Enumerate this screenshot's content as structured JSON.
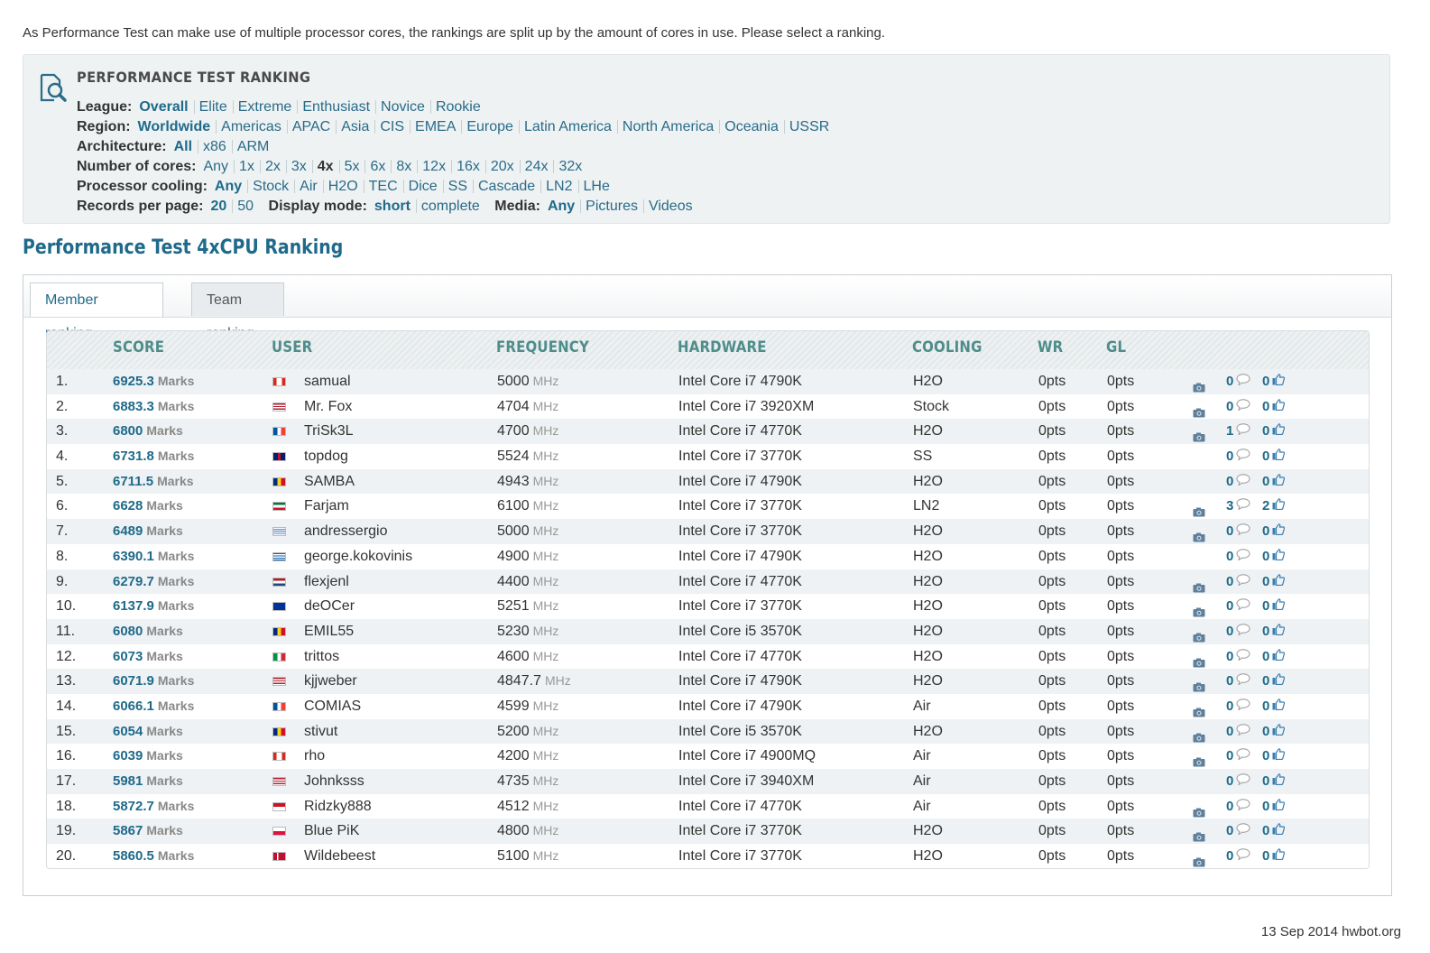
{
  "intro": "As Performance Test can make use of multiple processor cores, the rankings are split up by the amount of cores in use. Please select a ranking.",
  "filters": {
    "title": "PERFORMANCE TEST RANKING",
    "league": {
      "label": "League:",
      "options": [
        "Overall",
        "Elite",
        "Extreme",
        "Enthusiast",
        "Novice",
        "Rookie"
      ],
      "selected": "Overall"
    },
    "region": {
      "label": "Region:",
      "options": [
        "Worldwide",
        "Americas",
        "APAC",
        "Asia",
        "CIS",
        "EMEA",
        "Europe",
        "Latin America",
        "North America",
        "Oceania",
        "USSR"
      ],
      "selected": "Worldwide"
    },
    "architecture": {
      "label": "Architecture:",
      "options": [
        "All",
        "x86",
        "ARM"
      ],
      "selected": "All"
    },
    "cores": {
      "label": "Number of cores:",
      "options": [
        "Any",
        "1x",
        "2x",
        "3x",
        "4x",
        "5x",
        "6x",
        "8x",
        "12x",
        "16x",
        "20x",
        "24x",
        "32x"
      ],
      "selected": "4x"
    },
    "cooling": {
      "label": "Processor cooling:",
      "options": [
        "Any",
        "Stock",
        "Air",
        "H2O",
        "TEC",
        "Dice",
        "SS",
        "Cascade",
        "LN2",
        "LHe"
      ],
      "selected": "Any"
    },
    "records": {
      "label": "Records per page:",
      "options": [
        "20",
        "50"
      ],
      "selected": "20"
    },
    "display": {
      "label": "Display mode:",
      "options": [
        "short",
        "complete"
      ],
      "selected": "short"
    },
    "media": {
      "label": "Media:",
      "options": [
        "Any",
        "Pictures",
        "Videos"
      ],
      "selected": "Any"
    }
  },
  "section_title": "Performance Test 4xCPU Ranking",
  "tabs": [
    {
      "label": "Member ranking",
      "active": true
    },
    {
      "label": "Team ranking",
      "active": false
    }
  ],
  "columns": {
    "score": "SCORE",
    "user": "USER",
    "frequency": "FREQUENCY",
    "hardware": "HARDWARE",
    "cooling": "COOLING",
    "wr": "WR",
    "gl": "GL"
  },
  "score_unit": "Marks",
  "freq_unit": "MHz",
  "rows": [
    {
      "rank": "1.",
      "score": "6925.3",
      "flag": "ca",
      "user": "samual",
      "freq": "5000",
      "hw": "Intel Core i7 4790K",
      "cooling": "H2O",
      "wr": "0pts",
      "gl": "0pts",
      "camera": true,
      "comments": "0",
      "likes": "0"
    },
    {
      "rank": "2.",
      "score": "6883.3",
      "flag": "us",
      "user": "Mr. Fox",
      "freq": "4704",
      "hw": "Intel Core i7 3920XM",
      "cooling": "Stock",
      "wr": "0pts",
      "gl": "0pts",
      "camera": true,
      "comments": "0",
      "likes": "0"
    },
    {
      "rank": "3.",
      "score": "6800",
      "flag": "fr",
      "user": "TriSk3L",
      "freq": "4700",
      "hw": "Intel Core i7 4770K",
      "cooling": "H2O",
      "wr": "0pts",
      "gl": "0pts",
      "camera": true,
      "comments": "1",
      "likes": "0"
    },
    {
      "rank": "4.",
      "score": "6731.8",
      "flag": "gb",
      "user": "topdog",
      "freq": "5524",
      "hw": "Intel Core i7 3770K",
      "cooling": "SS",
      "wr": "0pts",
      "gl": "0pts",
      "camera": false,
      "comments": "0",
      "likes": "0"
    },
    {
      "rank": "5.",
      "score": "6711.5",
      "flag": "ro",
      "user": "SAMBA",
      "freq": "4943",
      "hw": "Intel Core i7 4790K",
      "cooling": "H2O",
      "wr": "0pts",
      "gl": "0pts",
      "camera": false,
      "comments": "0",
      "likes": "0"
    },
    {
      "rank": "6.",
      "score": "6628",
      "flag": "kw",
      "user": "Farjam",
      "freq": "6100",
      "hw": "Intel Core i7 3770K",
      "cooling": "LN2",
      "wr": "0pts",
      "gl": "0pts",
      "camera": true,
      "comments": "3",
      "likes": "2"
    },
    {
      "rank": "7.",
      "score": "6489",
      "flag": "uy",
      "user": "andressergio",
      "freq": "5000",
      "hw": "Intel Core i7 3770K",
      "cooling": "H2O",
      "wr": "0pts",
      "gl": "0pts",
      "camera": true,
      "comments": "0",
      "likes": "0"
    },
    {
      "rank": "8.",
      "score": "6390.1",
      "flag": "gr",
      "user": "george.kokovinis",
      "freq": "4900",
      "hw": "Intel Core i7 4790K",
      "cooling": "H2O",
      "wr": "0pts",
      "gl": "0pts",
      "camera": false,
      "comments": "0",
      "likes": "0"
    },
    {
      "rank": "9.",
      "score": "6279.7",
      "flag": "nl",
      "user": "flexjenl",
      "freq": "4400",
      "hw": "Intel Core i7 4770K",
      "cooling": "H2O",
      "wr": "0pts",
      "gl": "0pts",
      "camera": true,
      "comments": "0",
      "likes": "0"
    },
    {
      "rank": "10.",
      "score": "6137.9",
      "flag": "eu",
      "user": "deOCer",
      "freq": "5251",
      "hw": "Intel Core i7 3770K",
      "cooling": "H2O",
      "wr": "0pts",
      "gl": "0pts",
      "camera": true,
      "comments": "0",
      "likes": "0"
    },
    {
      "rank": "11.",
      "score": "6080",
      "flag": "ro",
      "user": "EMIL55",
      "freq": "5230",
      "hw": "Intel Core i5 3570K",
      "cooling": "H2O",
      "wr": "0pts",
      "gl": "0pts",
      "camera": true,
      "comments": "0",
      "likes": "0"
    },
    {
      "rank": "12.",
      "score": "6073",
      "flag": "it",
      "user": "trittos",
      "freq": "4600",
      "hw": "Intel Core i7 4770K",
      "cooling": "H2O",
      "wr": "0pts",
      "gl": "0pts",
      "camera": true,
      "comments": "0",
      "likes": "0"
    },
    {
      "rank": "13.",
      "score": "6071.9",
      "flag": "us",
      "user": "kjjweber",
      "freq": "4847.7",
      "hw": "Intel Core i7 4790K",
      "cooling": "H2O",
      "wr": "0pts",
      "gl": "0pts",
      "camera": true,
      "comments": "0",
      "likes": "0"
    },
    {
      "rank": "14.",
      "score": "6066.1",
      "flag": "fr",
      "user": "COMIAS",
      "freq": "4599",
      "hw": "Intel Core i7 4790K",
      "cooling": "Air",
      "wr": "0pts",
      "gl": "0pts",
      "camera": true,
      "comments": "0",
      "likes": "0"
    },
    {
      "rank": "15.",
      "score": "6054",
      "flag": "ro",
      "user": "stivut",
      "freq": "5200",
      "hw": "Intel Core i5 3570K",
      "cooling": "H2O",
      "wr": "0pts",
      "gl": "0pts",
      "camera": true,
      "comments": "0",
      "likes": "0"
    },
    {
      "rank": "16.",
      "score": "6039",
      "flag": "ca",
      "user": "rho",
      "freq": "4200",
      "hw": "Intel Core i7 4900MQ",
      "cooling": "Air",
      "wr": "0pts",
      "gl": "0pts",
      "camera": true,
      "comments": "0",
      "likes": "0"
    },
    {
      "rank": "17.",
      "score": "5981",
      "flag": "us",
      "user": "Johnksss",
      "freq": "4735",
      "hw": "Intel Core i7 3940XM",
      "cooling": "Air",
      "wr": "0pts",
      "gl": "0pts",
      "camera": false,
      "comments": "0",
      "likes": "0"
    },
    {
      "rank": "18.",
      "score": "5872.7",
      "flag": "id",
      "user": "Ridzky888",
      "freq": "4512",
      "hw": "Intel Core i7 4770K",
      "cooling": "Air",
      "wr": "0pts",
      "gl": "0pts",
      "camera": true,
      "comments": "0",
      "likes": "0"
    },
    {
      "rank": "19.",
      "score": "5867",
      "flag": "pl",
      "user": "Blue PiK",
      "freq": "4800",
      "hw": "Intel Core i7 3770K",
      "cooling": "H2O",
      "wr": "0pts",
      "gl": "0pts",
      "camera": true,
      "comments": "0",
      "likes": "0"
    },
    {
      "rank": "20.",
      "score": "5860.5",
      "flag": "dk",
      "user": "Wildebeest",
      "freq": "5100",
      "hw": "Intel Core i7 3770K",
      "cooling": "H2O",
      "wr": "0pts",
      "gl": "0pts",
      "camera": true,
      "comments": "0",
      "likes": "0"
    }
  ],
  "footer": "13 Sep 2014 hwbot.org",
  "colors": {
    "accent": "#1f6a8a",
    "header_text": "#4e8d8a",
    "filter_bg": "#eef2f3",
    "row_alt": "#eef2f4"
  }
}
